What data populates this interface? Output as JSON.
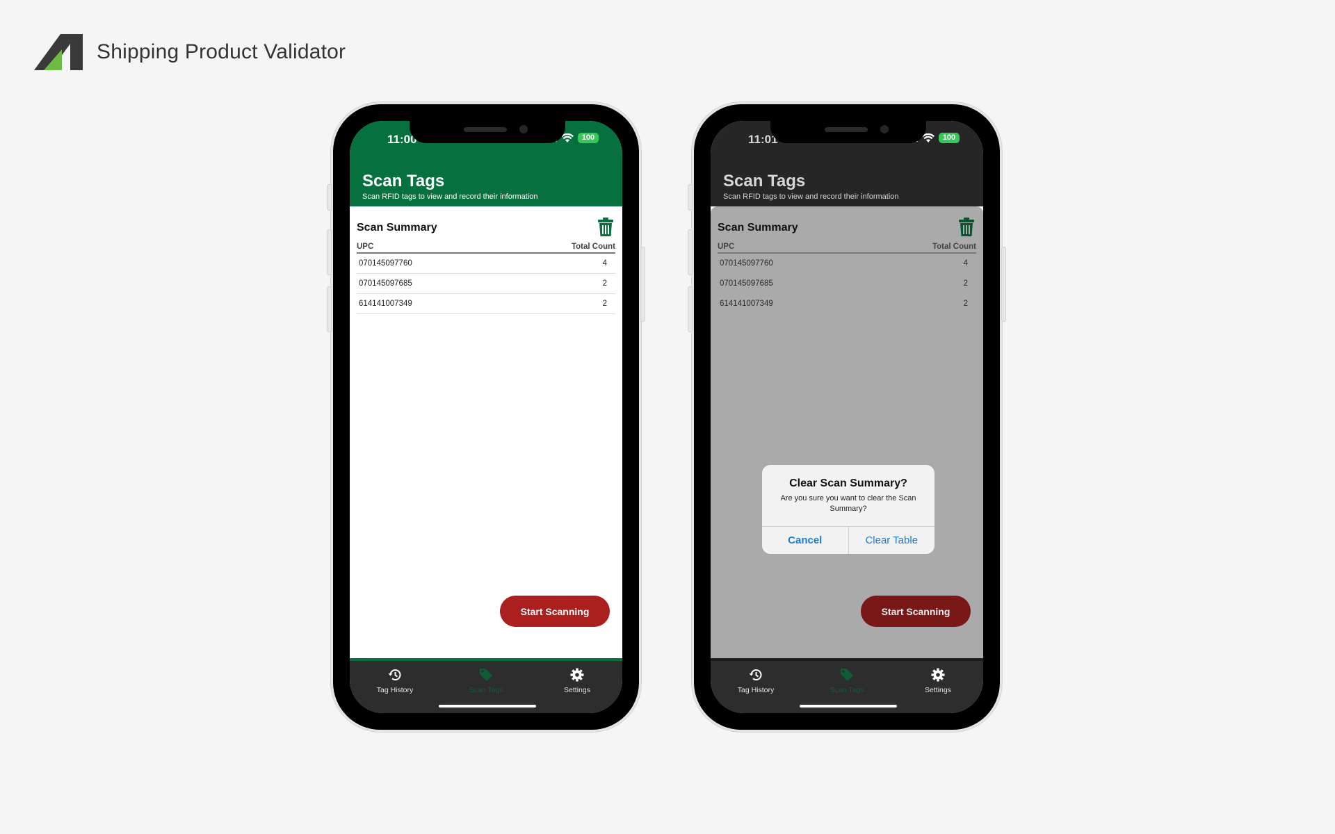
{
  "app": {
    "title": "Shipping Product Validator"
  },
  "colors": {
    "brand_green": "#06703f",
    "accent_red": "#ac1f1f",
    "link_blue": "#1d7bd6",
    "battery_green": "#38c759"
  },
  "screens": {
    "left": {
      "status": {
        "time": "11:00",
        "battery": "100"
      },
      "header": {
        "title": "Scan Tags",
        "subtitle": "Scan RFID tags to view and record their information"
      },
      "summary": {
        "title": "Scan Summary",
        "columns": [
          "UPC",
          "Total Count"
        ],
        "rows": [
          {
            "upc": "070145097760",
            "count": "4"
          },
          {
            "upc": "070145097685",
            "count": "2"
          },
          {
            "upc": "614141007349",
            "count": "2"
          }
        ]
      },
      "start_button": "Start Scanning",
      "tabs": [
        {
          "label": "Tag History",
          "icon": "history-icon"
        },
        {
          "label": "Scan Tags",
          "icon": "tag-icon",
          "active": true
        },
        {
          "label": "Settings",
          "icon": "gear-icon"
        }
      ]
    },
    "right": {
      "status": {
        "time": "11:01",
        "battery": "100"
      },
      "header": {
        "title": "Scan Tags",
        "subtitle": "Scan RFID tags to view and record their information"
      },
      "summary": {
        "title": "Scan Summary",
        "columns": [
          "UPC",
          "Total Count"
        ],
        "rows": [
          {
            "upc": "070145097760",
            "count": "4"
          },
          {
            "upc": "070145097685",
            "count": "2"
          },
          {
            "upc": "614141007349",
            "count": "2"
          }
        ]
      },
      "start_button": "Start Scanning",
      "tabs": [
        {
          "label": "Tag History",
          "icon": "history-icon"
        },
        {
          "label": "Scan Tags",
          "icon": "tag-icon",
          "active": true
        },
        {
          "label": "Settings",
          "icon": "gear-icon"
        }
      ],
      "dialog": {
        "title": "Clear Scan Summary?",
        "message": "Are you sure you want to clear the Scan Summary?",
        "cancel": "Cancel",
        "confirm": "Clear Table"
      }
    }
  }
}
